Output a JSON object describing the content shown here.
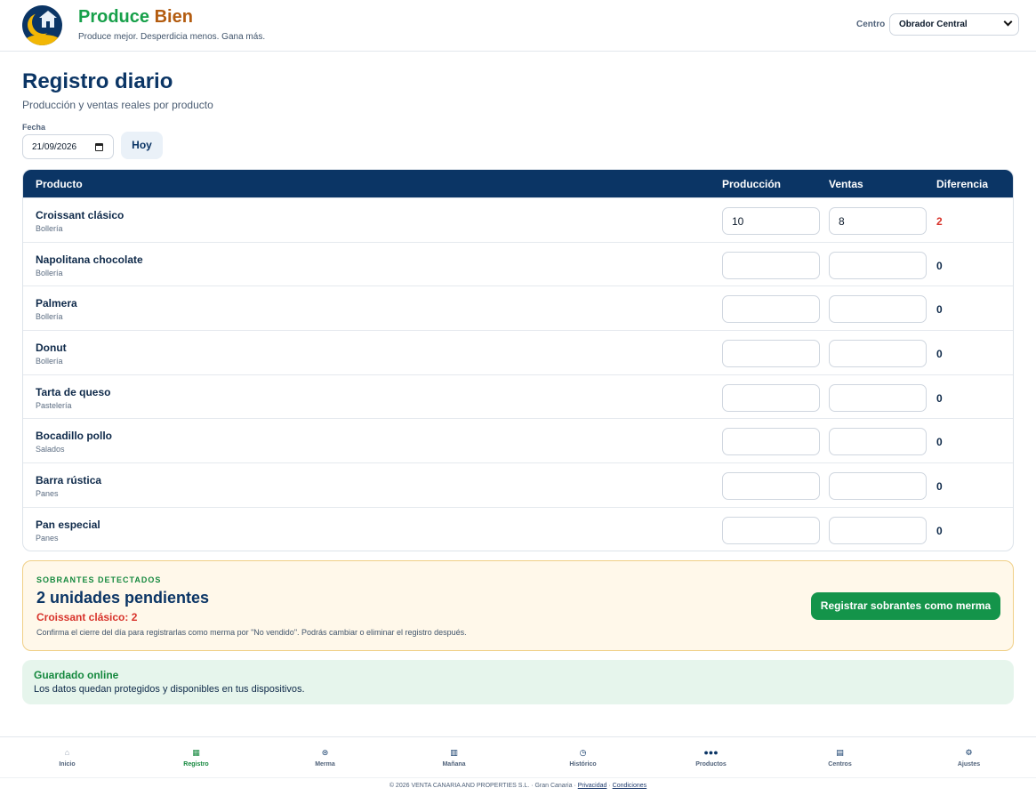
{
  "header": {
    "brand_part1": "Produce",
    "brand_part2": "Bien",
    "tagline": "Produce mejor. Desperdicia menos. Gana más.",
    "centro_label": "Centro",
    "centro_value": "Obrador Central"
  },
  "page": {
    "title": "Registro diario",
    "subtitle": "Producción y ventas reales por producto",
    "fecha_label": "Fecha",
    "fecha_value": "21/09/2026",
    "hoy_label": "Hoy"
  },
  "table": {
    "headers": {
      "producto": "Producto",
      "produccion": "Producción",
      "ventas": "Ventas",
      "diferencia": "Diferencia"
    },
    "rows": [
      {
        "name": "Croissant clásico",
        "category": "Bollería",
        "produccion": "10",
        "ventas": "8",
        "diferencia": "2"
      },
      {
        "name": "Napolitana chocolate",
        "category": "Bollería",
        "produccion": "",
        "ventas": "",
        "diferencia": "0"
      },
      {
        "name": "Palmera",
        "category": "Bollería",
        "produccion": "",
        "ventas": "",
        "diferencia": "0"
      },
      {
        "name": "Donut",
        "category": "Bollería",
        "produccion": "",
        "ventas": "",
        "diferencia": "0"
      },
      {
        "name": "Tarta de queso",
        "category": "Pastelería",
        "produccion": "",
        "ventas": "",
        "diferencia": "0"
      },
      {
        "name": "Bocadillo pollo",
        "category": "Salados",
        "produccion": "",
        "ventas": "",
        "diferencia": "0"
      },
      {
        "name": "Barra rústica",
        "category": "Panes",
        "produccion": "",
        "ventas": "",
        "diferencia": "0"
      },
      {
        "name": "Pan especial",
        "category": "Panes",
        "produccion": "",
        "ventas": "",
        "diferencia": "0"
      }
    ]
  },
  "sobrantes": {
    "kicker": "SOBRANTES DETECTADOS",
    "title": "2 unidades pendientes",
    "item": "Croissant clásico: 2",
    "note": "Confirma el cierre del día para registrarlas como merma por \"No vendido\". Podrás cambiar o eliminar el registro después.",
    "button": "Registrar sobrantes como merma"
  },
  "saved": {
    "title": "Guardado online",
    "text": "Los datos quedan protegidos y disponibles en tus dispositivos."
  },
  "nav": {
    "items": [
      {
        "label": "Inicio",
        "icon": "⌂"
      },
      {
        "label": "Registro",
        "icon": "▦"
      },
      {
        "label": "Merma",
        "icon": "⊜"
      },
      {
        "label": "Mañana",
        "icon": "▥"
      },
      {
        "label": "Histórico",
        "icon": "◷"
      },
      {
        "label": "Productos",
        "icon": "●●●"
      },
      {
        "label": "Centros",
        "icon": "▤"
      },
      {
        "label": "Ajustes",
        "icon": "⚙"
      }
    ]
  },
  "footer": {
    "text": "© 2026 VENTA CANARIA AND PROPERTIES S.L. · Gran Canaria ·",
    "privacy": "Privacidad",
    "sep": "·",
    "terms": "Condiciones"
  },
  "colors": {
    "navy": "#0b3565",
    "green": "#16893f",
    "orange": "#b35c10",
    "red": "#d8332b"
  }
}
